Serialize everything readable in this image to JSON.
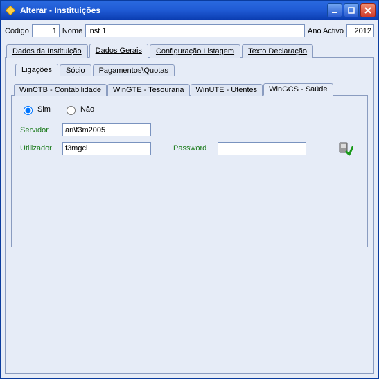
{
  "window": {
    "title": "Alterar - Instituições"
  },
  "header": {
    "codigo_label": "Código",
    "codigo_value": "1",
    "nome_label": "Nome",
    "nome_value": "inst 1",
    "ano_label": "Ano Activo",
    "ano_value": "2012"
  },
  "main_tabs": {
    "dados_inst": "Dados da Instituição",
    "dados_gerais": "Dados Gerais",
    "config_list": "Configuração Listagem",
    "texto_decl": "Texto Declaração"
  },
  "sub_tabs": {
    "ligacoes": "Ligações",
    "socio": "Sócio",
    "pagamentos": "Pagamentos\\Quotas"
  },
  "inner_tabs": {
    "winctb": "WinCTB - Contabilidade",
    "wingte": "WinGTE - Tesouraria",
    "winute": "WinUTE - Utentes",
    "wingcs": "WinGCS - Saúde"
  },
  "form": {
    "radio_sim": "Sim",
    "radio_nao": "Não",
    "servidor_label": "Servidor",
    "servidor_value": "ari\\f3m2005",
    "utilizador_label": "Utilizador",
    "utilizador_value": "f3mgci",
    "password_label": "Password",
    "password_value": ""
  }
}
